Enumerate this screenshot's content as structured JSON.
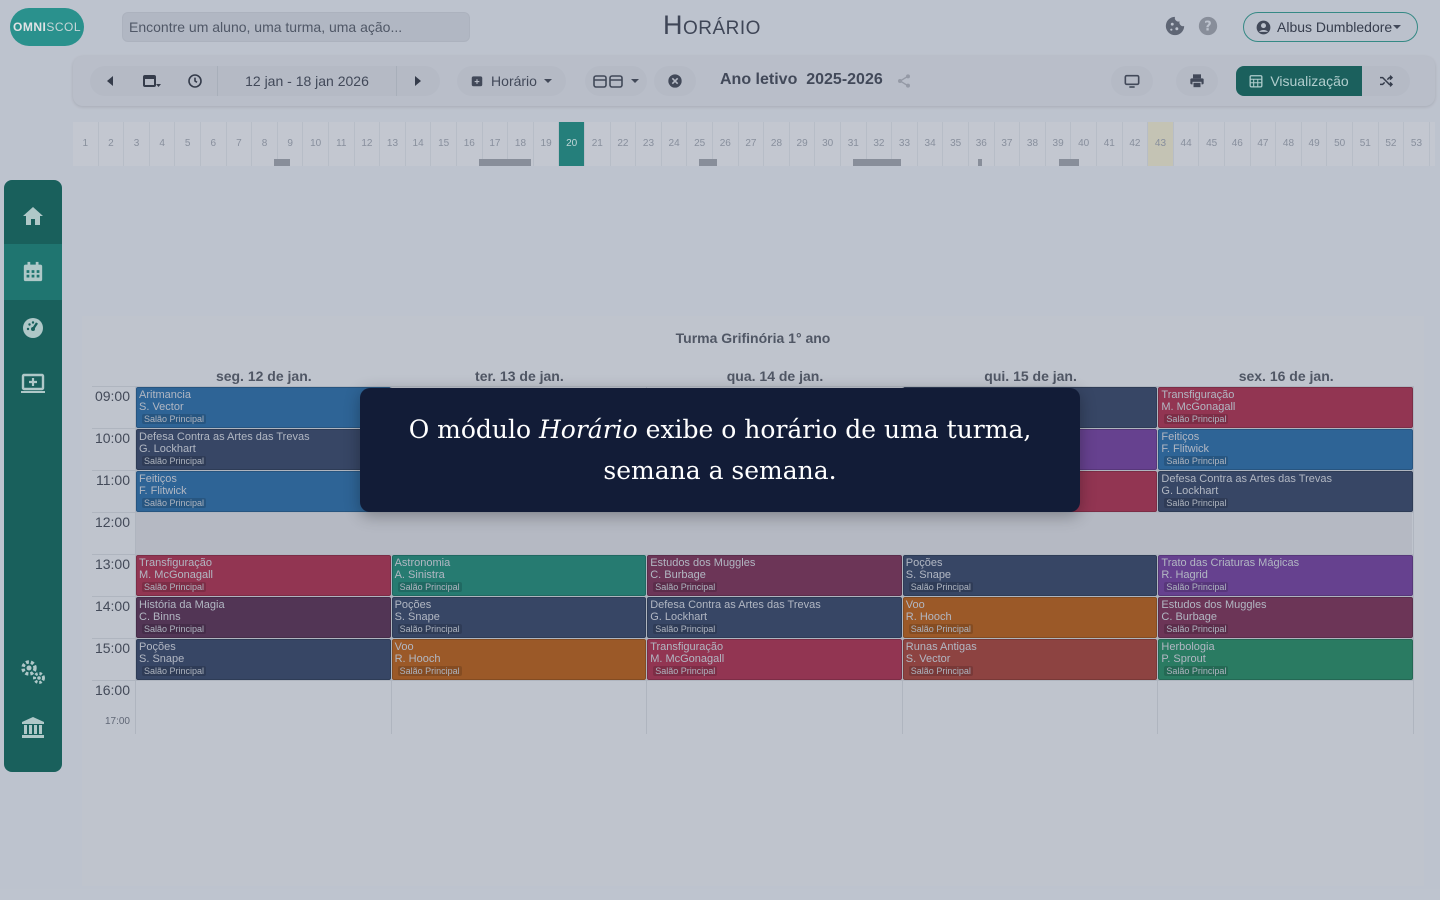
{
  "header": {
    "logo_main": "OMNI",
    "logo_rest": "SCOL",
    "search_placeholder": "Encontre um aluno, uma turma, uma ação...",
    "title": "Horário",
    "user": "Albus Dumbledore"
  },
  "toolbar": {
    "date_range": "12 jan - 18 jan 2026",
    "view_label": "Horário",
    "school_year_label": "Ano letivo",
    "school_year": "2025-2026",
    "visualization_label": "Visualização"
  },
  "weeks": {
    "numbers": [
      "1",
      "2",
      "3",
      "4",
      "5",
      "6",
      "7",
      "8",
      "9",
      "10",
      "11",
      "12",
      "13",
      "14",
      "15",
      "16",
      "17",
      "18",
      "19",
      "20",
      "21",
      "22",
      "23",
      "24",
      "25",
      "26",
      "27",
      "28",
      "29",
      "30",
      "31",
      "32",
      "33",
      "34",
      "35",
      "36",
      "37",
      "38",
      "39",
      "40",
      "41",
      "42",
      "43",
      "44",
      "45",
      "46",
      "47",
      "48",
      "49",
      "50",
      "51",
      "52",
      "53"
    ],
    "active": "20",
    "highlighted": "43"
  },
  "sidebar": {
    "icons": [
      "home-icon",
      "calendar-icon",
      "dashboard-icon",
      "monitor-plus-icon",
      "cogs-icon",
      "institution-icon"
    ]
  },
  "schedule": {
    "title": "Turma Grifinória 1° ano",
    "days": [
      "seg. 12 de jan.",
      "ter. 13 de jan.",
      "qua. 14 de jan.",
      "qui. 15 de jan.",
      "sex. 16 de jan."
    ],
    "times": [
      "09:00",
      "10:00",
      "11:00",
      "12:00",
      "13:00",
      "14:00",
      "15:00",
      "16:00"
    ],
    "end_time": "17:00",
    "colors": {
      "blue": "#3470a6",
      "navy": "#3e4e6e",
      "red": "#a63b58",
      "teal": "#2b8a7c",
      "plum": "#5d3b5c",
      "orange": "#b06428",
      "purple": "#74489e",
      "wine": "#7a3b5e",
      "rust": "#a04a45",
      "green": "#2f8a6a"
    },
    "events": [
      {
        "day": 0,
        "slot": 0,
        "subject": "Aritmancia",
        "teacher": "S. Vector",
        "room": "Salão Principal",
        "color": "blue"
      },
      {
        "day": 0,
        "slot": 1,
        "subject": "Defesa Contra as Artes das Trevas",
        "teacher": "G. Lockhart",
        "room": "Salão Principal",
        "color": "navy"
      },
      {
        "day": 0,
        "slot": 2,
        "subject": "Feitiços",
        "teacher": "F. Flitwick",
        "room": "Salão Principal",
        "color": "blue"
      },
      {
        "day": 3,
        "slot": 0,
        "subject": "",
        "teacher": "",
        "room": "",
        "color": "navy"
      },
      {
        "day": 3,
        "slot": 1,
        "subject": "",
        "teacher": "",
        "room": "",
        "color": "purple"
      },
      {
        "day": 3,
        "slot": 2,
        "subject": "",
        "teacher": "",
        "room": "",
        "color": "red"
      },
      {
        "day": 4,
        "slot": 0,
        "subject": "Transfiguração",
        "teacher": "M. McGonagall",
        "room": "Salão Principal",
        "color": "red"
      },
      {
        "day": 4,
        "slot": 1,
        "subject": "Feitiços",
        "teacher": "F. Flitwick",
        "room": "Salão Principal",
        "color": "blue"
      },
      {
        "day": 4,
        "slot": 2,
        "subject": "Defesa Contra as Artes das Trevas",
        "teacher": "G. Lockhart",
        "room": "Salão Principal",
        "color": "navy"
      },
      {
        "day": 0,
        "slot": 4,
        "subject": "Transfiguração",
        "teacher": "M. McGonagall",
        "room": "Salão Principal",
        "color": "red"
      },
      {
        "day": 0,
        "slot": 5,
        "subject": "História da Magia",
        "teacher": "C. Binns",
        "room": "Salão Principal",
        "color": "plum"
      },
      {
        "day": 0,
        "slot": 6,
        "subject": "Poções",
        "teacher": "S. Snape",
        "room": "Salão Principal",
        "color": "navy"
      },
      {
        "day": 1,
        "slot": 4,
        "subject": "Astronomia",
        "teacher": "A. Sinistra",
        "room": "Salão Principal",
        "color": "teal"
      },
      {
        "day": 1,
        "slot": 5,
        "subject": "Poções",
        "teacher": "S. Snape",
        "room": "Salão Principal",
        "color": "navy"
      },
      {
        "day": 1,
        "slot": 6,
        "subject": "Voo",
        "teacher": "R. Hooch",
        "room": "Salão Principal",
        "color": "orange"
      },
      {
        "day": 2,
        "slot": 4,
        "subject": "Estudos dos Muggles",
        "teacher": "C. Burbage",
        "room": "Salão Principal",
        "color": "wine"
      },
      {
        "day": 2,
        "slot": 5,
        "subject": "Defesa Contra as Artes das Trevas",
        "teacher": "G. Lockhart",
        "room": "Salão Principal",
        "color": "navy"
      },
      {
        "day": 2,
        "slot": 6,
        "subject": "Transfiguração",
        "teacher": "M. McGonagall",
        "room": "Salão Principal",
        "color": "red"
      },
      {
        "day": 3,
        "slot": 4,
        "subject": "Poções",
        "teacher": "S. Snape",
        "room": "Salão Principal",
        "color": "navy"
      },
      {
        "day": 3,
        "slot": 5,
        "subject": "Voo",
        "teacher": "R. Hooch",
        "room": "Salão Principal",
        "color": "orange"
      },
      {
        "day": 3,
        "slot": 6,
        "subject": "Runas Antigas",
        "teacher": "S. Vector",
        "room": "Salão Principal",
        "color": "rust"
      },
      {
        "day": 4,
        "slot": 4,
        "subject": "Trato das Criaturas Mágicas",
        "teacher": "R. Hagrid",
        "room": "Salão Principal",
        "color": "purple"
      },
      {
        "day": 4,
        "slot": 5,
        "subject": "Estudos dos Muggles",
        "teacher": "C. Burbage",
        "room": "Salão Principal",
        "color": "wine"
      },
      {
        "day": 4,
        "slot": 6,
        "subject": "Herbologia",
        "teacher": "P. Sprout",
        "room": "Salão Principal",
        "color": "green"
      }
    ]
  },
  "tooltip": {
    "before": "O módulo ",
    "emphasis": "Horário",
    "after": " exibe o horário de uma turma, semana a semana."
  }
}
